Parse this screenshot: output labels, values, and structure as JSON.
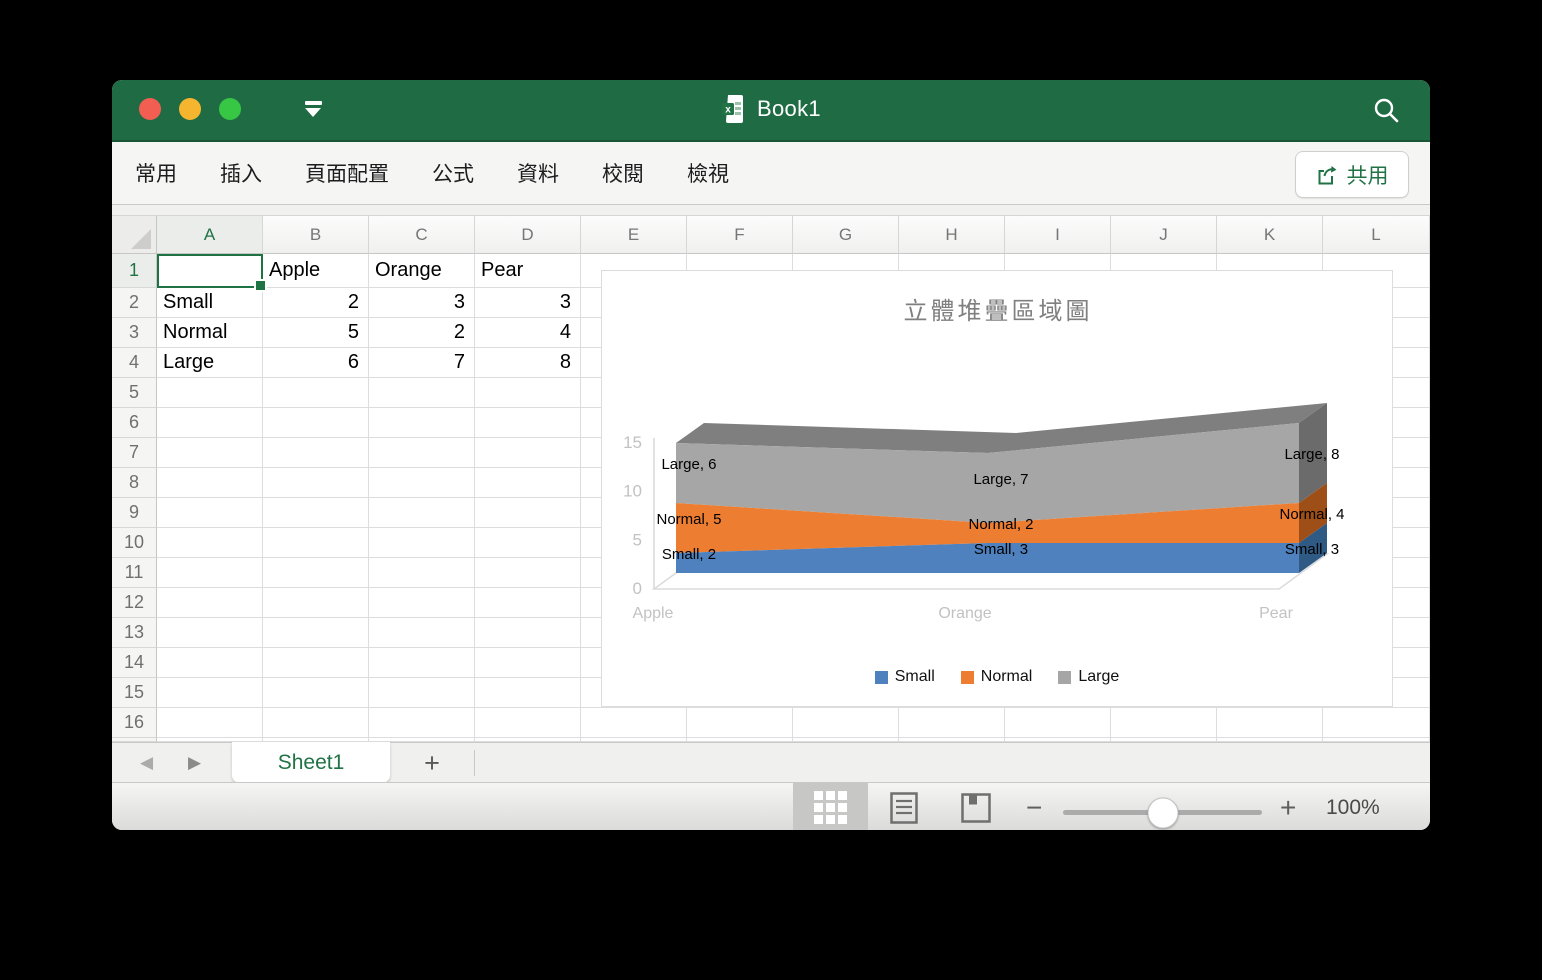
{
  "titlebar": {
    "title": "Book1",
    "doc_icon": "excel-document-icon",
    "search_icon": "magnifier",
    "ribbon_toggle_icon": "collapse-ribbon"
  },
  "ribbon": {
    "tabs": [
      {
        "label": "常用"
      },
      {
        "label": "插入"
      },
      {
        "label": "頁面配置"
      },
      {
        "label": "公式"
      },
      {
        "label": "資料"
      },
      {
        "label": "校閱"
      },
      {
        "label": "檢視"
      }
    ],
    "share": {
      "label": "共用",
      "icon": "share-arrow",
      "color": "#217346"
    }
  },
  "grid": {
    "columns": [
      "A",
      "B",
      "C",
      "D",
      "E",
      "F",
      "G",
      "H",
      "I",
      "J",
      "K",
      "L"
    ],
    "row_count": 16,
    "selected_cell": "A1",
    "selected_column": "A",
    "selected_row": 1,
    "cells": [
      {
        "ref": "B1",
        "value": "Apple",
        "align": "left"
      },
      {
        "ref": "C1",
        "value": "Orange",
        "align": "left"
      },
      {
        "ref": "D1",
        "value": "Pear",
        "align": "left"
      },
      {
        "ref": "A2",
        "value": "Small",
        "align": "left"
      },
      {
        "ref": "B2",
        "value": "2",
        "align": "right"
      },
      {
        "ref": "C2",
        "value": "3",
        "align": "right"
      },
      {
        "ref": "D2",
        "value": "3",
        "align": "right"
      },
      {
        "ref": "A3",
        "value": "Normal",
        "align": "left"
      },
      {
        "ref": "B3",
        "value": "5",
        "align": "right"
      },
      {
        "ref": "C3",
        "value": "2",
        "align": "right"
      },
      {
        "ref": "D3",
        "value": "4",
        "align": "right"
      },
      {
        "ref": "A4",
        "value": "Large",
        "align": "left"
      },
      {
        "ref": "B4",
        "value": "6",
        "align": "right"
      },
      {
        "ref": "C4",
        "value": "7",
        "align": "right"
      },
      {
        "ref": "D4",
        "value": "8",
        "align": "right"
      }
    ]
  },
  "chart_data": {
    "type": "area",
    "variant": "3d-stacked",
    "title": "立體堆疊區域圖",
    "categories": [
      "Apple",
      "Orange",
      "Pear"
    ],
    "series": [
      {
        "name": "Small",
        "values": [
          2,
          3,
          3
        ],
        "color": "#4E81BE",
        "side_color": "#2F5A84"
      },
      {
        "name": "Normal",
        "values": [
          5,
          2,
          4
        ],
        "color": "#ED7D31",
        "side_color": "#9E4E17"
      },
      {
        "name": "Large",
        "values": [
          6,
          7,
          8
        ],
        "color": "#A6A6A6",
        "side_color": "#6B6B6B",
        "top_color": "#7F7F7F"
      }
    ],
    "ylim": [
      0,
      15
    ],
    "yticks": [
      0,
      5,
      10,
      15
    ],
    "xlabel": "",
    "ylabel": "",
    "legend_position": "bottom",
    "data_labels": true,
    "label_format": "{series}, {value}",
    "title_color": "#7F7F7F",
    "axis_text_color": "#C2C2C2"
  },
  "sheet_tabs": {
    "active_tab": "Sheet1",
    "add_label": "+",
    "nav_left_icon": "◀",
    "nav_right_icon": "▶"
  },
  "status_bar": {
    "views": [
      "normal-view",
      "page-layout-view",
      "page-break-view"
    ],
    "active_view": "normal-view",
    "zoom_minus": "−",
    "zoom_plus": "+",
    "zoom_level": "100%"
  }
}
